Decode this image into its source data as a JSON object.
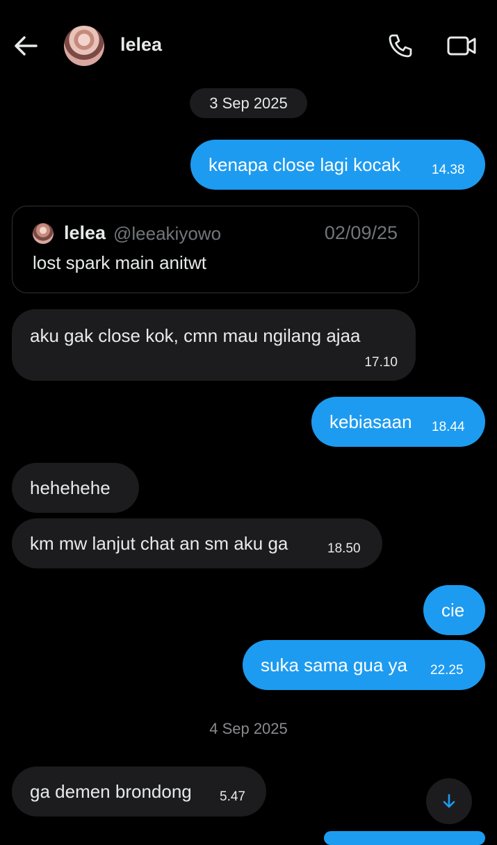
{
  "header": {
    "contact_name": "lelea",
    "icons": [
      "back-arrow-icon",
      "phone-icon",
      "video-camera-icon"
    ]
  },
  "date_separators": [
    "3 Sep 2025",
    "4 Sep 2025"
  ],
  "messages": [
    {
      "direction": "sent",
      "text": "kenapa close lagi kocak",
      "time": "14.38"
    },
    {
      "direction": "received",
      "type": "quoted-post",
      "quote": {
        "name": "lelea",
        "handle": "@leeakiyowo",
        "date": "02/09/25",
        "text": "lost spark main anitwt"
      }
    },
    {
      "direction": "received",
      "text": "aku gak close kok, cmn mau ngilang ajaa",
      "time": "17.10"
    },
    {
      "direction": "sent",
      "text": "kebiasaan",
      "time": "18.44"
    },
    {
      "direction": "received",
      "text": "hehehehe"
    },
    {
      "direction": "received",
      "text": "km mw lanjut chat an sm aku ga",
      "time": "18.50"
    },
    {
      "direction": "sent",
      "text": "cie"
    },
    {
      "direction": "sent",
      "text": "suka sama gua ya",
      "time": "22.25"
    },
    {
      "direction": "received",
      "text": "ga demen brondong",
      "time": "5.47"
    }
  ],
  "colors": {
    "background": "#000000",
    "sent_bubble": "#1d9bf0",
    "received_bubble": "#1c1c1e",
    "accent": "#1d9bf0"
  },
  "scroll_button_icon": "arrow-down-icon"
}
